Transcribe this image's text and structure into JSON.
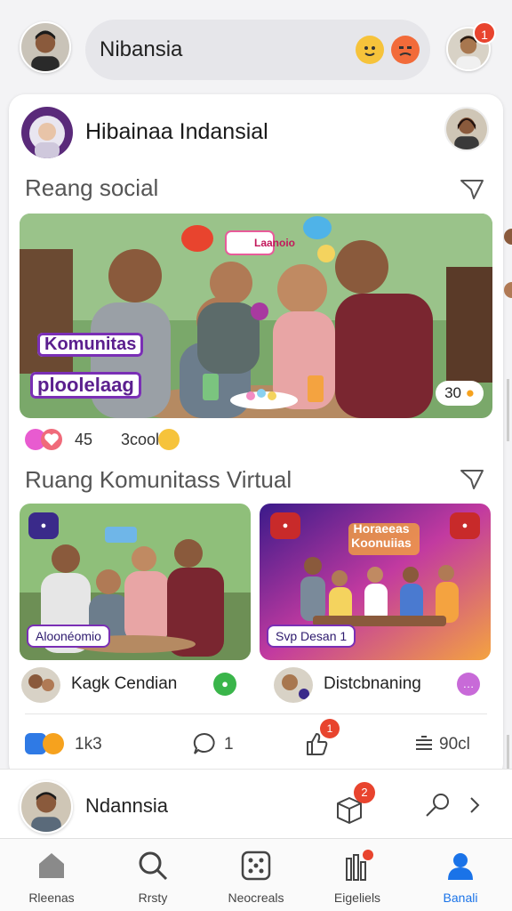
{
  "header": {
    "search_text": "Nibansia",
    "notification_count": "1"
  },
  "post": {
    "author_name": "Hibainaa Indansial",
    "section_title": "Reang social",
    "hero_tags": [
      "Komunitas",
      "ploolelaag"
    ],
    "hero_bubbles": [
      "Laanoio"
    ],
    "hero_count": "30",
    "reactions": {
      "count": "45",
      "label": "3cool"
    }
  },
  "virtual": {
    "section_title": "Ruang Komunitass Virtual",
    "cards": [
      {
        "label": "Aloonéomio",
        "author": "Kagk Cendian"
      },
      {
        "label": "Svp Desan 1",
        "title_overlay": "Horaeeas Koonuiias",
        "author": "Distcbnaning"
      }
    ],
    "actions": {
      "reactions_count": "1k3",
      "comments_count": "1",
      "shares_badge": "1",
      "views_count": "90cl"
    }
  },
  "userbar": {
    "name": "Ndannsia",
    "badge": "2"
  },
  "nav": {
    "items": [
      {
        "label": "Rleenas"
      },
      {
        "label": "Rrsty"
      },
      {
        "label": "Neocreals"
      },
      {
        "label": "Eigeliels"
      },
      {
        "label": "Banali"
      }
    ],
    "active_index": 4
  },
  "colors": {
    "accent": "#1a73e8",
    "badge_red": "#e8442e",
    "tag_purple": "#7a2fb5"
  }
}
